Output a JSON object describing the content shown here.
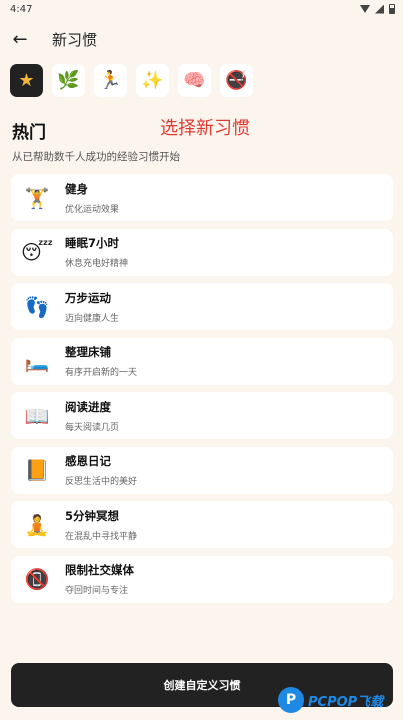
{
  "status_bar": {
    "time": "4:47"
  },
  "app_bar": {
    "back_glyph": "←",
    "title": "新习惯"
  },
  "categories": [
    {
      "icon": "star-icon",
      "glyph": "★",
      "active": true
    },
    {
      "icon": "leaf-icon",
      "glyph": "🌿",
      "active": false
    },
    {
      "icon": "running-icon",
      "glyph": "🏃",
      "active": false
    },
    {
      "icon": "sparkle-icon",
      "glyph": "✨",
      "active": false
    },
    {
      "icon": "brain-icon",
      "glyph": "🧠",
      "active": false
    },
    {
      "icon": "no-smoking-icon",
      "glyph": "🚭",
      "active": false
    }
  ],
  "section": {
    "title": "热门",
    "overlay": "选择新习惯",
    "subtitle": "从已帮助数千人成功的经验习惯开始"
  },
  "habits": [
    {
      "icon": "weightlifter-icon",
      "glyph": "🏋️",
      "name": "健身",
      "desc": "优化运动效果"
    },
    {
      "icon": "sleeping-face-icon",
      "glyph": "😴",
      "name": "睡眠7小时",
      "desc": "休息充电好精神"
    },
    {
      "icon": "footprints-icon",
      "glyph": "👣",
      "name": "万步运动",
      "desc": "迈向健康人生"
    },
    {
      "icon": "bed-icon",
      "glyph": "🛏️",
      "name": "整理床铺",
      "desc": "有序开启新的一天"
    },
    {
      "icon": "open-book-icon",
      "glyph": "📖",
      "name": "阅读进度",
      "desc": "每天阅读几页"
    },
    {
      "icon": "notebook-icon",
      "glyph": "📙",
      "name": "感恩日记",
      "desc": "反思生活中的美好"
    },
    {
      "icon": "meditation-icon",
      "glyph": "🧘",
      "name": "5分钟冥想",
      "desc": "在混乱中寻找平静"
    },
    {
      "icon": "no-phone-icon",
      "glyph": "📵",
      "name": "限制社交媒体",
      "desc": "夺回时间与专注"
    }
  ],
  "create_button": {
    "label": "创建自定义习惯"
  },
  "watermark": {
    "logo": "P",
    "text": "PCPOP飞载"
  }
}
